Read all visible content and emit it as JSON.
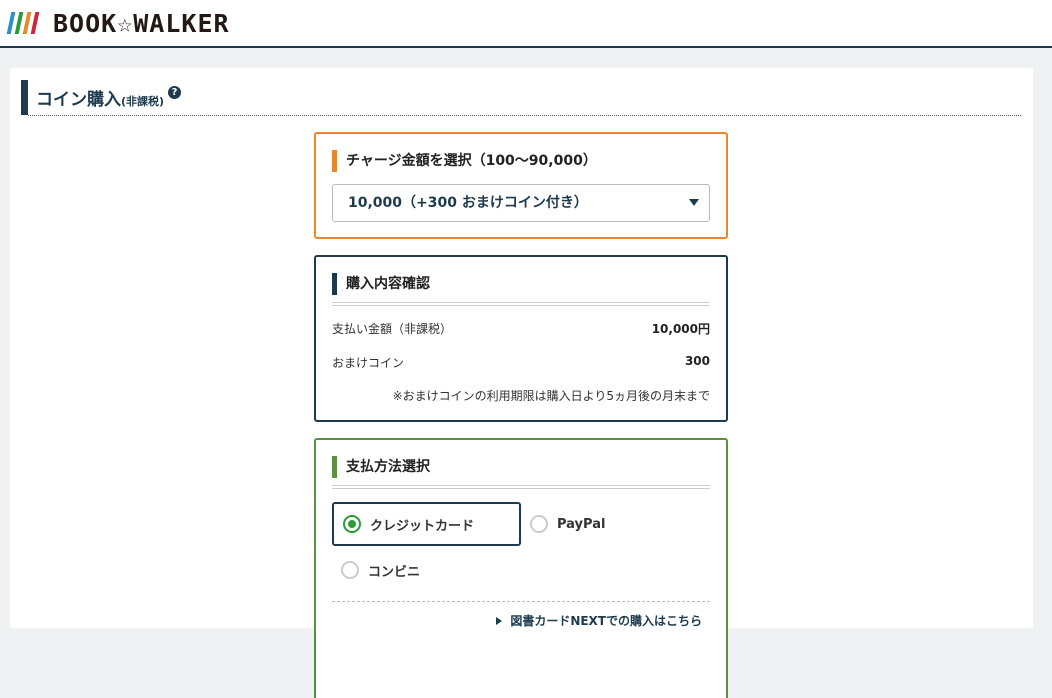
{
  "header": {
    "logo_text": "BOOK☆WALKER",
    "logo_bar_colors": [
      "#2a8fd0",
      "#2e9b3a",
      "#e8882e",
      "#d0253a"
    ]
  },
  "page": {
    "title": "コイン購入",
    "title_suffix": "(非課税)",
    "help_icon_glyph": "?"
  },
  "charge": {
    "heading": "チャージ金額を選択（100～90,000）",
    "selected_value": "10,000（+300 おまけコイン付き）"
  },
  "confirm": {
    "heading": "購入内容確認",
    "rows": [
      {
        "label": "支払い金額（非課税）",
        "value": "10,000円"
      },
      {
        "label": "おまけコイン",
        "value": "300"
      }
    ],
    "note": "※おまけコインの利用期限は購入日より5ヵ月後の月末まで"
  },
  "payment": {
    "heading": "支払方法選択",
    "options": [
      {
        "label": "クレジットカード",
        "selected": true
      },
      {
        "label": "PayPal",
        "selected": false
      },
      {
        "label": "コンビニ",
        "selected": false
      }
    ],
    "next_link": "図書カードNEXTでの購入はこちら"
  },
  "colors": {
    "navy": "#1d3a4e",
    "orange": "#e8882e",
    "green": "#5c8f3f",
    "radio_green": "#2e9b3a"
  }
}
